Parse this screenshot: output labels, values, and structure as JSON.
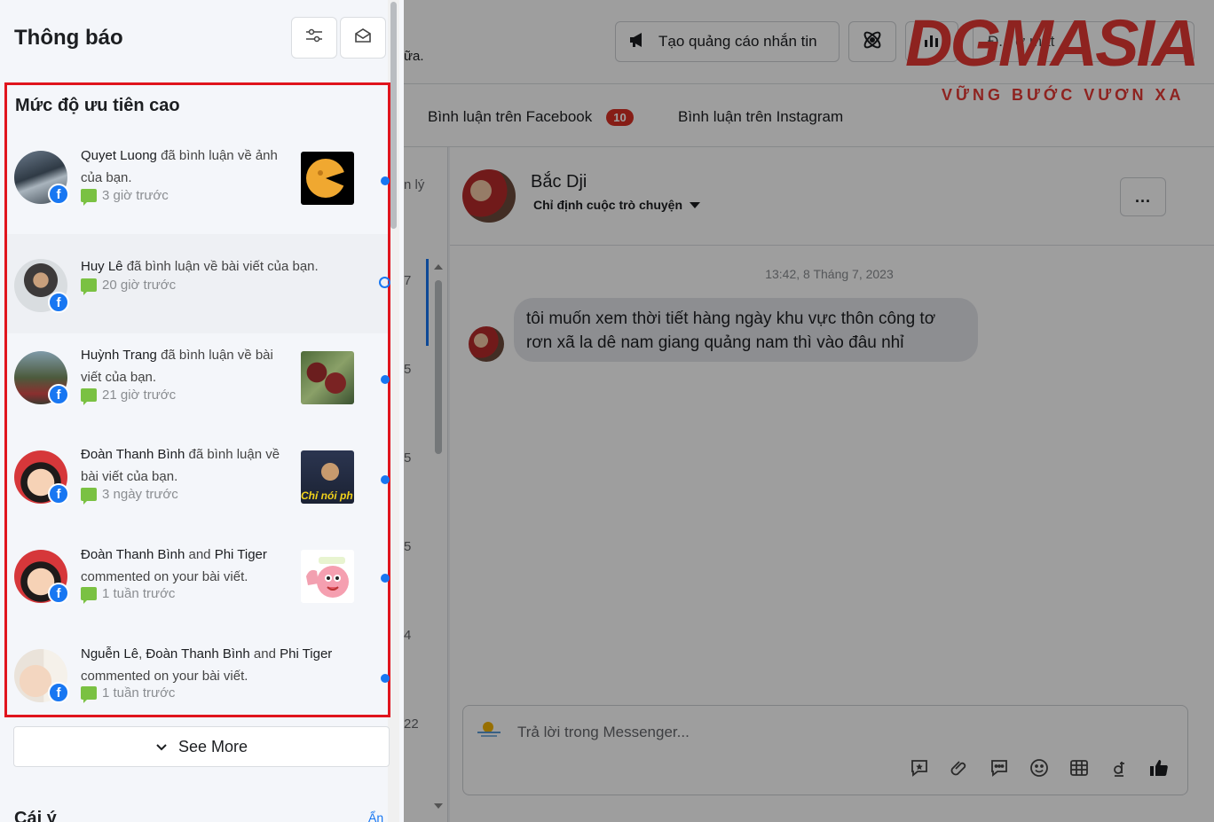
{
  "background": {
    "note_fragment": "ữa.",
    "top_buttons": {
      "create_ad": "Tạo quảng cáo nhắn tin",
      "extra": "Đ...  ở mặt"
    },
    "tabs": [
      {
        "label": "Bình luận trên Facebook",
        "badge": "10"
      },
      {
        "label": "Bình luận trên Instagram"
      }
    ],
    "list_fragments": [
      "n lý",
      "7",
      "5",
      "5",
      "5",
      "4",
      "22"
    ],
    "chat": {
      "name": "Bắc Dji",
      "assign_label": "Chỉ định cuộc trò chuyện",
      "more_label": "...",
      "timestamp": "13:42, 8 Tháng 7, 2023",
      "message": "tôi muốn xem thời tiết hàng ngày khu vực thôn công tơ rơn xã la dê nam giang quảng nam thì vào đâu nhỉ",
      "composer_placeholder": "Trả lời trong Messenger..."
    },
    "logo": {
      "text": "DGMASIA",
      "tagline": "VỮNG BƯỚC VƯƠN XA"
    }
  },
  "panel": {
    "title": "Thông báo",
    "priority_section": {
      "title": "Mức độ ưu tiên cao",
      "notifications": [
        {
          "actors": "Quyet Luong",
          "action": "đã bình luận về ảnh của bạn.",
          "time": "3 giờ trước",
          "unread": true
        },
        {
          "actors": "Huy Lê",
          "action": "đã bình luận về bài viết của bạn.",
          "time": "20 giờ trước",
          "unread": false
        },
        {
          "actors": "Huỳnh Trang",
          "action": "đã bình luận về bài viết của bạn.",
          "time": "21 giờ trước",
          "unread": true
        },
        {
          "actors": "Đoàn Thanh Bình",
          "action": "đã bình luận về bài viết của bạn.",
          "time": "3 ngày trước",
          "unread": true
        },
        {
          "actor1": "Đoàn Thanh Bình",
          "joiner": "and",
          "actor2": "Phi Tiger",
          "action": "commented on your bài viết.",
          "time": "1 tuần trước",
          "unread": true
        },
        {
          "actor0": "Nguễn Lê",
          "sep": ",",
          "actor1": "Đoàn Thanh Bình",
          "joiner": "and",
          "actor2": "Phi Tiger",
          "action": "commented on your bài viết.",
          "time": "1 tuần trước",
          "unread": true
        }
      ],
      "thumbnail_captions": {
        "n4": "Chỉ nói ph"
      }
    },
    "see_more": "See More",
    "next_section": "Cái ý",
    "next_action": "Ẩn"
  },
  "colors": {
    "facebook_blue": "#1877f2",
    "highlight_red": "#e0141d",
    "badge_red": "#d93025",
    "comment_green": "#7ac142"
  }
}
